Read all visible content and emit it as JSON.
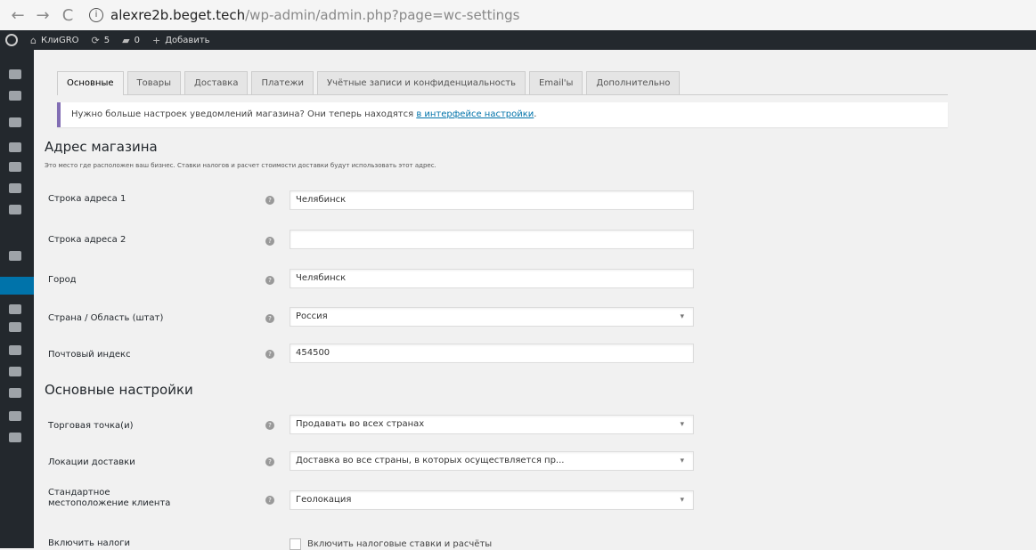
{
  "browser": {
    "back": "←",
    "forward": "→",
    "reload": "C",
    "info": "i",
    "url_host": "alexre2b.beget.tech",
    "url_path": "/wp-admin/admin.php?page=wc-settings"
  },
  "admin_bar": {
    "site": "КлиGRO",
    "updates": "5",
    "comments": "0",
    "add": "Добавить"
  },
  "tabs": [
    "Основные",
    "Товары",
    "Доставка",
    "Платежи",
    "Учётные записи и конфиденциальность",
    "Email'ы",
    "Дополнительно"
  ],
  "notice": {
    "text": "Нужно больше настроек уведомлений магазина? Они теперь находятся ",
    "link": "в интерфейсе настройки",
    "suffix": "."
  },
  "store_address": {
    "title": "Адрес магазина",
    "description": "Это место где расположен ваш бизнес. Ставки налогов и расчет стоимости доставки будут использовать этот адрес."
  },
  "fields": [
    {
      "label": "Строка адреса 1",
      "value": "Челябинск"
    },
    {
      "label": "Строка адреса 2",
      "value": ""
    },
    {
      "label": "Город",
      "value": "Челябинск"
    },
    {
      "label": "Страна / Область (штат)",
      "value": "Россия"
    },
    {
      "label": "Почтовый индекс",
      "value": "454500"
    }
  ],
  "general": {
    "title": "Основные настройки",
    "selling_label": "Торговая точка(и)",
    "selling_value": "Продавать во всех странах",
    "shipping_label": "Локации доставки",
    "shipping_value": "Доставка во все страны, в которых осуществляется пр...",
    "default_location_label_1": "Стандартное",
    "default_location_label_2": "местоположение клиента",
    "default_location_value": "Геолокация",
    "taxes_label": "Включить налоги",
    "taxes_checkbox": "Включить налоговые ставки и расчёты"
  },
  "help_symbol": "?"
}
